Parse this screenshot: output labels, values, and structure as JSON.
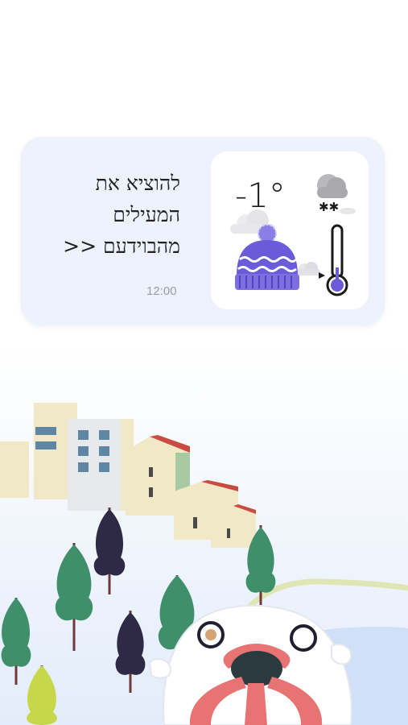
{
  "notification": {
    "message_lines": [
      "להוציא את",
      "המעילים",
      "מהבוידעם <<"
    ],
    "time": "12:00"
  },
  "weather": {
    "temperature": "-1°",
    "condition_icon": "snow-cloud-icon",
    "hat_icon": "winter-hat-icon",
    "thermometer_icon": "thermometer-icon"
  },
  "colors": {
    "card_background": "#edf2fc",
    "tile_background": "#ffffff",
    "hat_purple": "#6b5bd8",
    "tree_green": "#3f8f6b",
    "tree_dark": "#2e2a45",
    "building_cream": "#f0e8c6",
    "roof_red": "#c94c43",
    "creature_pink": "#e87373"
  }
}
